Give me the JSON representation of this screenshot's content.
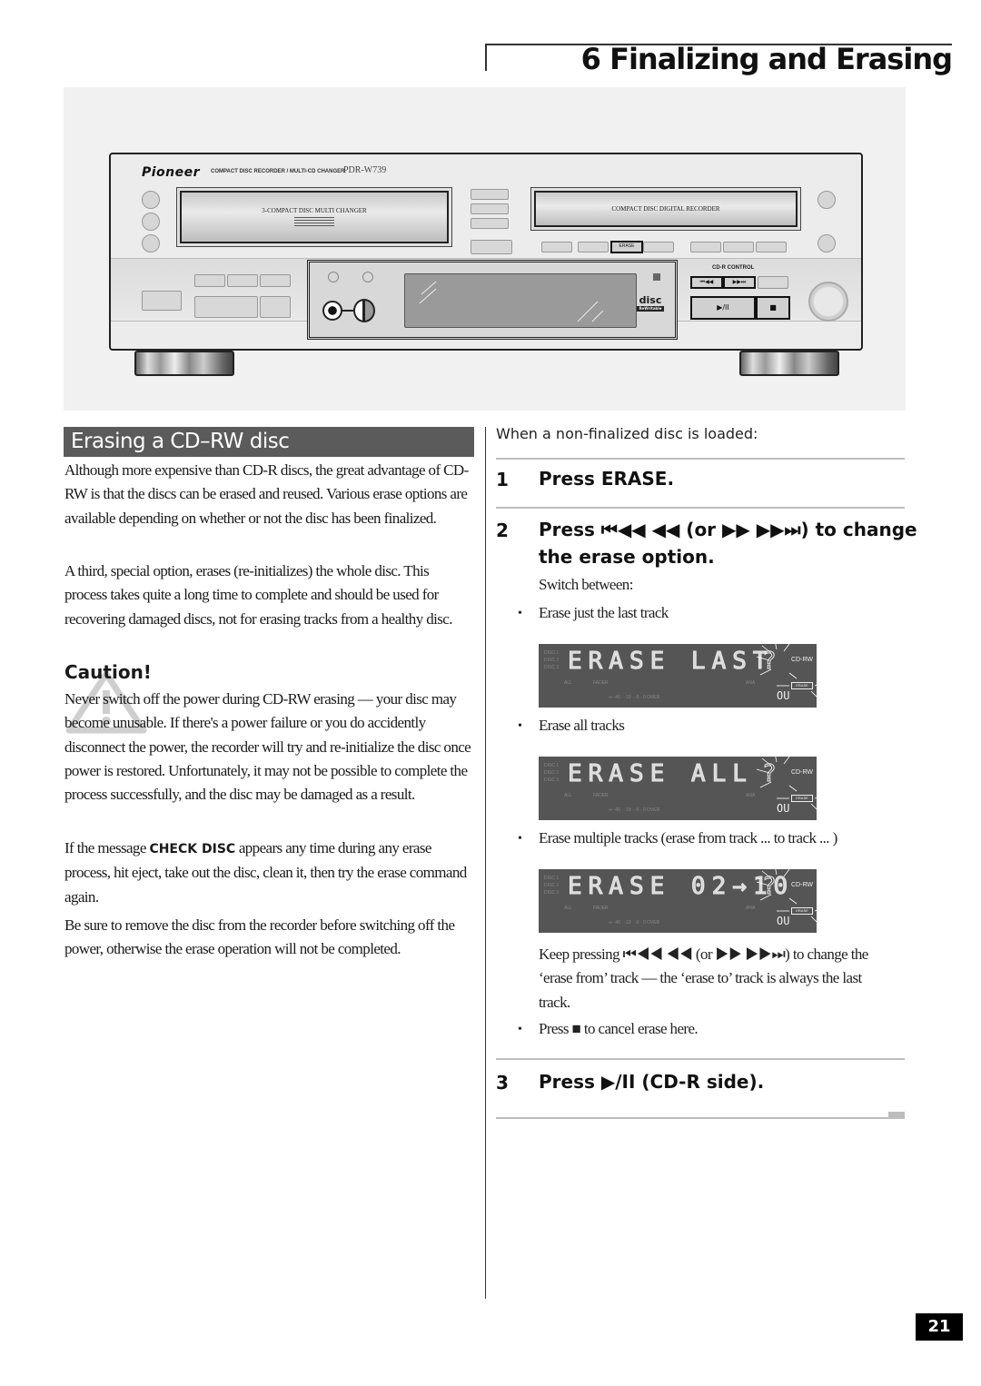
{
  "header": {
    "chapter_title": "6 Finalizing and Erasing"
  },
  "illustration": {
    "brand": "Pioneer",
    "brand_subtitle": "COMPACT DISC RECORDER / MULTI-CD CHANGER",
    "model": "PDR-W739",
    "left_tray_label": "3-COMPACT DISC MULTI CHANGER",
    "right_tray_label": "COMPACT DISC DIGITAL RECORDER",
    "erase_button_label": "ERASE",
    "control_label": "CD-R CONTROL",
    "rew_button": "⏮◀◀",
    "ff_button": "▶▶⏭",
    "play_pause_button": "▶/II",
    "stop_button": "■",
    "disc_logo": "disc",
    "disc_logo_sub": "ReWritable"
  },
  "left": {
    "section_title": "Erasing a CD–RW disc",
    "para1": "Although more expensive than CD-R discs, the great advantage of CD-RW is that the discs can be erased and reused. Various erase options are available depending on whether or not the disc has been finalized.",
    "para2": "A third, special option, erases (re-initializes) the whole disc. This process takes quite a long time to complete and should be used for recovering damaged discs, not for erasing tracks from a healthy disc.",
    "caution_heading": "Caution!",
    "caution_text": "Never switch off the power during CD-RW erasing — your disc may become unusable. If there's a power failure or you do accidently disconnect the power, the recorder will try and re-initialize the disc once power is restored. Unfortunately, it may not be possible to complete the process successfully, and the disc may be damaged as a result.",
    "para3_before": "If the message ",
    "para3_code": "CHECK DISC",
    "para3_after": " appears any time during any erase process, hit eject, take out the disc, clean it, then try the erase command again.",
    "para4": "Be sure to remove the disc from the recorder before switching off the power, otherwise the erase operation will not be completed."
  },
  "right": {
    "intro": "When a non-finalized disc is loaded:",
    "steps": [
      {
        "num": "1",
        "text": "Press ERASE."
      },
      {
        "num": "2",
        "line1": "Press ⏮◀◀ ◀◀ (or ▶▶ ▶▶⏭) to change",
        "line2": "the erase option."
      },
      {
        "num": "3",
        "text": "Press ▶/II (CD-R side)."
      }
    ],
    "switch_between": "Switch between:",
    "options": [
      {
        "bullet": "•",
        "label": "Erase just the last track",
        "display": "ERASE LAST"
      },
      {
        "bullet": "•",
        "label": "Erase all tracks",
        "display": "ERASE ALL"
      },
      {
        "bullet": "•",
        "label": "Erase multiple tracks (erase from track ... to track ... )",
        "display": "ERASE 02→10"
      }
    ],
    "display_common": {
      "question": "?",
      "cdrw": "CD-RW",
      "erase_tag": "ERASE",
      "disc_labels": [
        "DISC 1",
        "DISC 2",
        "DISC 3"
      ],
      "all": "ALL",
      "fader": "FADER",
      "ana": "ANA",
      "scale": "-∞  -40  ·  -10  ·  -6  ·  0  OVER",
      "ou": "OU"
    },
    "keep_pressing": "Keep pressing ⏮◀◀ ◀◀ (or ▶▶ ▶▶⏭) to change the ‘erase from’ track — the ‘erase to’ track is always the last track.",
    "cancel_bullet": "•",
    "cancel_text": "Press ■ to cancel erase here."
  },
  "footer": {
    "page_number": "21"
  }
}
